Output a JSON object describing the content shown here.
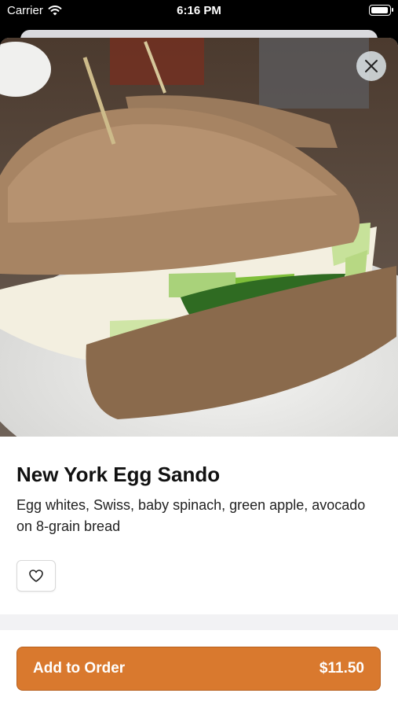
{
  "status_bar": {
    "carrier": "Carrier",
    "time": "6:16 PM",
    "battery_level": 1.0
  },
  "item": {
    "name": "New York Egg Sando",
    "description": "Egg whites, Swiss, baby spinach, green apple, avocado on 8-grain bread"
  },
  "actions": {
    "add_label": "Add to Order",
    "price": "$11.50"
  },
  "icons": {
    "close": "close-icon",
    "favorite": "heart-icon",
    "wifi": "wifi-icon",
    "battery": "battery-icon"
  },
  "colors": {
    "accent": "#d9792e",
    "text": "#111111"
  }
}
